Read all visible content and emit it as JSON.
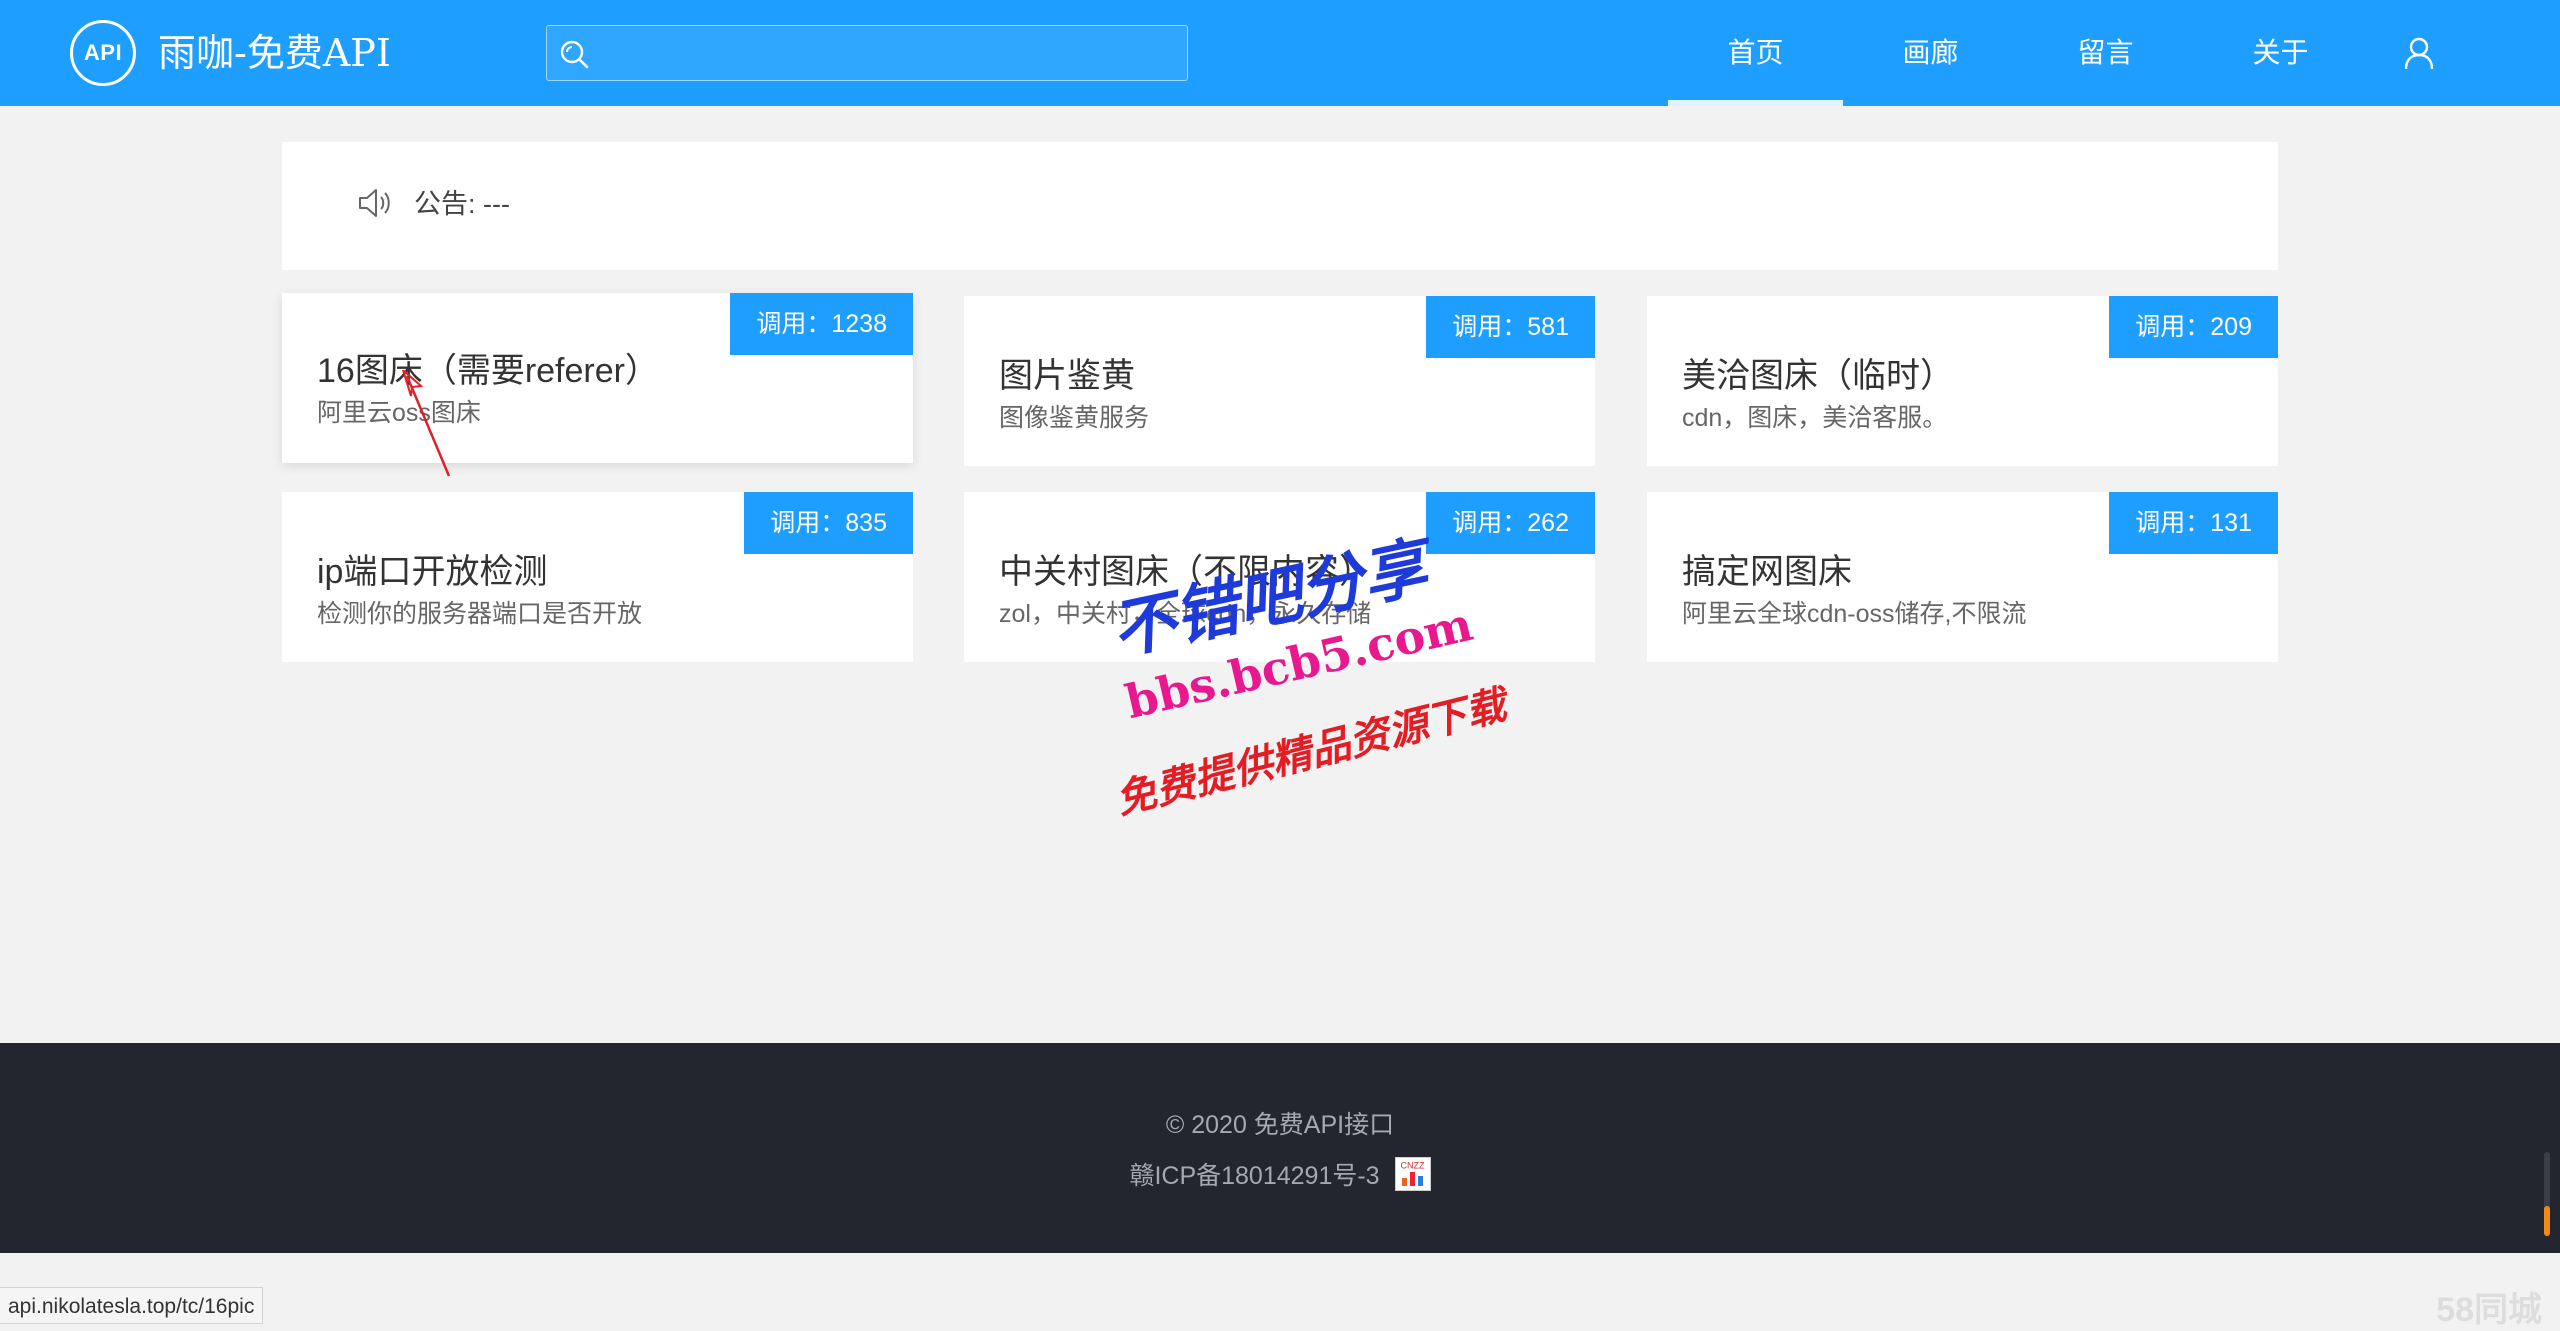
{
  "header": {
    "logo_text": "API",
    "site_title": "雨咖-免费API",
    "search": {
      "value": "",
      "placeholder": ""
    },
    "nav": [
      {
        "label": "首页",
        "active": true
      },
      {
        "label": "画廊",
        "active": false
      },
      {
        "label": "留言",
        "active": false
      },
      {
        "label": "关于",
        "active": false
      }
    ],
    "user_icon": "user-icon"
  },
  "notice": {
    "icon": "speaker-icon",
    "text": "公告: ---"
  },
  "cards": [
    {
      "title": "16图床（需要referer）",
      "desc": "阿里云oss图床",
      "badge": "调用：1238"
    },
    {
      "title": "图片鉴黄",
      "desc": "图像鉴黄服务",
      "badge": "调用：581"
    },
    {
      "title": "美洽图床（临时）",
      "desc": "cdn，图床，美洽客服。",
      "badge": "调用：209"
    },
    {
      "title": "ip端口开放检测",
      "desc": "检测你的服务器端口是否开放",
      "badge": "调用：835"
    },
    {
      "title": "中关村图床（不限内容）",
      "desc": "zol，中关村，全球cdn，永久存储",
      "badge": "调用：262"
    },
    {
      "title": "搞定网图床",
      "desc": "阿里云全球cdn-oss储存,不限流",
      "badge": "调用：131"
    }
  ],
  "watermark": {
    "line1": "不错吧分享",
    "line2": "bbs.bcb5.com",
    "line3": "免费提供精品资源下载"
  },
  "footer": {
    "copyright": "© 2020 免费API接口",
    "icp": "赣ICP备18014291号-3",
    "cnzz_label": "CNZZ"
  },
  "status_bar": {
    "url": "api.nikolatesla.top/tc/16pic"
  },
  "corner_mark": "58同城",
  "colors": {
    "primary": "#1e9fff",
    "footer_bg": "#23262e",
    "page_bg": "#f2f2f2"
  }
}
